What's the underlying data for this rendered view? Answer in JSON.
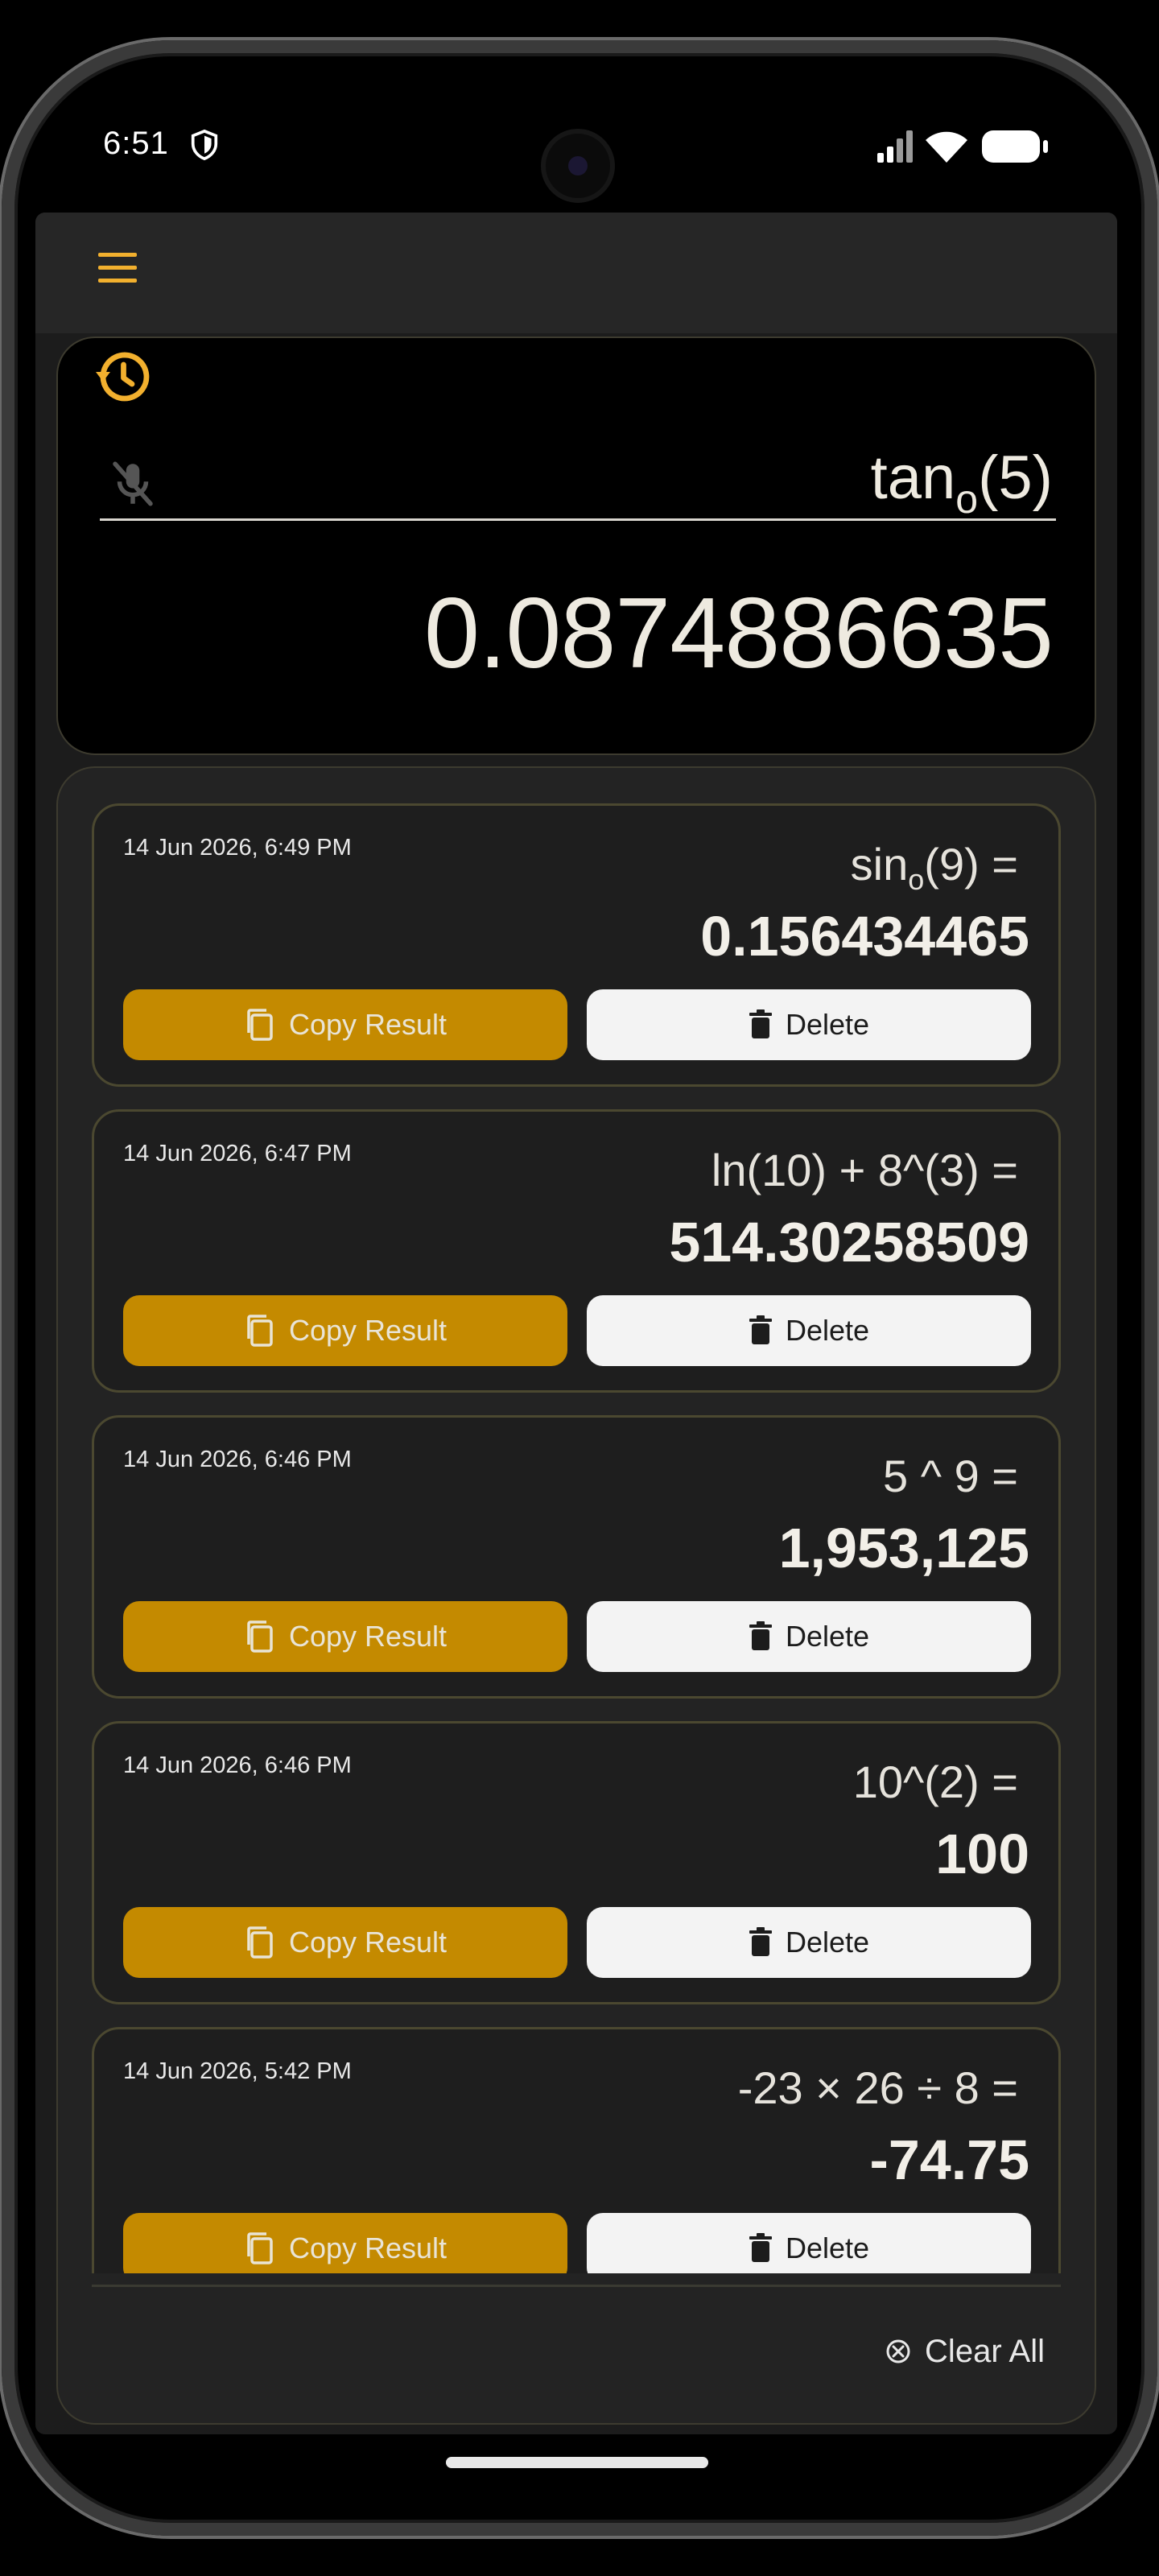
{
  "status_bar": {
    "time": "6:51"
  },
  "display": {
    "expression_prefix": "tan",
    "expression_sub": "o",
    "expression_suffix": "(5)",
    "result": "0.0874886635"
  },
  "history": [
    {
      "time": "14 Jun 2026, 6:49 PM",
      "expr_prefix": "sin",
      "expr_sub": "o",
      "expr_suffix": "(9) =",
      "result": "0.156434465",
      "copy_label": "Copy Result",
      "delete_label": "Delete"
    },
    {
      "time": "14 Jun 2026, 6:47 PM",
      "expr_prefix": "ln(10) + 8^(3) =",
      "expr_sub": "",
      "expr_suffix": "",
      "result": "514.30258509",
      "copy_label": "Copy Result",
      "delete_label": "Delete"
    },
    {
      "time": "14 Jun 2026, 6:46 PM",
      "expr_prefix": "5 ^ 9 =",
      "expr_sub": "",
      "expr_suffix": "",
      "result": "1,953,125",
      "copy_label": "Copy Result",
      "delete_label": "Delete"
    },
    {
      "time": "14 Jun 2026, 6:46 PM",
      "expr_prefix": "10^(2) =",
      "expr_sub": "",
      "expr_suffix": "",
      "result": "100",
      "copy_label": "Copy Result",
      "delete_label": "Delete"
    },
    {
      "time": "14 Jun 2026, 5:42 PM",
      "expr_prefix": "-23 × 26 ÷ 8 =",
      "expr_sub": "",
      "expr_suffix": "",
      "result": "-74.75",
      "copy_label": "Copy Result",
      "delete_label": "Delete"
    }
  ],
  "clear_all_label": "Clear All",
  "colors": {
    "accent": "#f2b02e",
    "copy_button": "#c48a00",
    "delete_button": "#f3f3f3",
    "background": "#1c1c1c"
  },
  "icons": [
    "shield-icon",
    "signal-icon",
    "wifi-icon",
    "battery-icon",
    "menu-icon",
    "history-icon",
    "mic-off-icon",
    "copy-icon",
    "trash-icon",
    "clear-circle-icon"
  ]
}
